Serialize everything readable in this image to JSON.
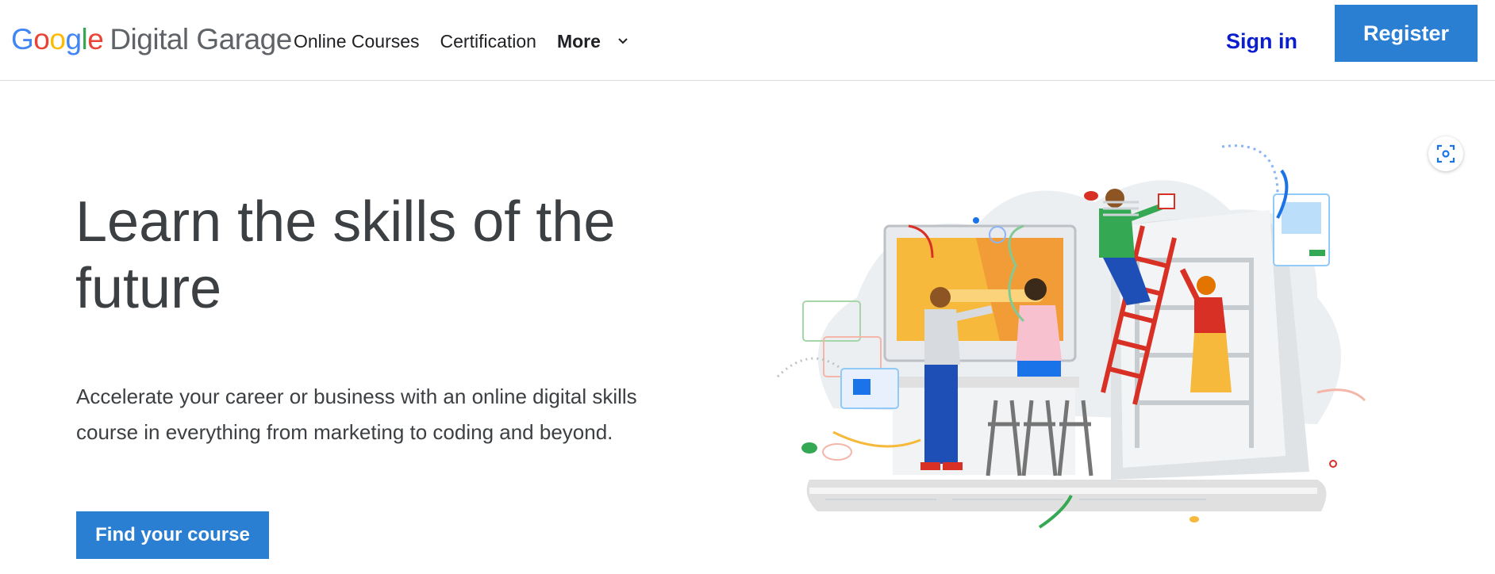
{
  "header": {
    "logo_google": [
      "G",
      "o",
      "o",
      "g",
      "l",
      "e"
    ],
    "logo_product": "Digital Garage",
    "nav": {
      "online_courses": "Online Courses",
      "certification": "Certification",
      "more": "More"
    },
    "sign_in": "Sign in",
    "register": "Register"
  },
  "hero": {
    "title": "Learn the skills of the future",
    "description": "Accelerate your career or business with an online digital skills course in everything from marketing to coding and beyond.",
    "cta": "Find your course"
  },
  "colors": {
    "primary_button": "#2b7fd3",
    "sign_in_link": "#0b1ecf",
    "text": "#3c4043"
  },
  "icons": {
    "more_dropdown": "chevron-down-icon",
    "visual_search": "lens-icon"
  }
}
